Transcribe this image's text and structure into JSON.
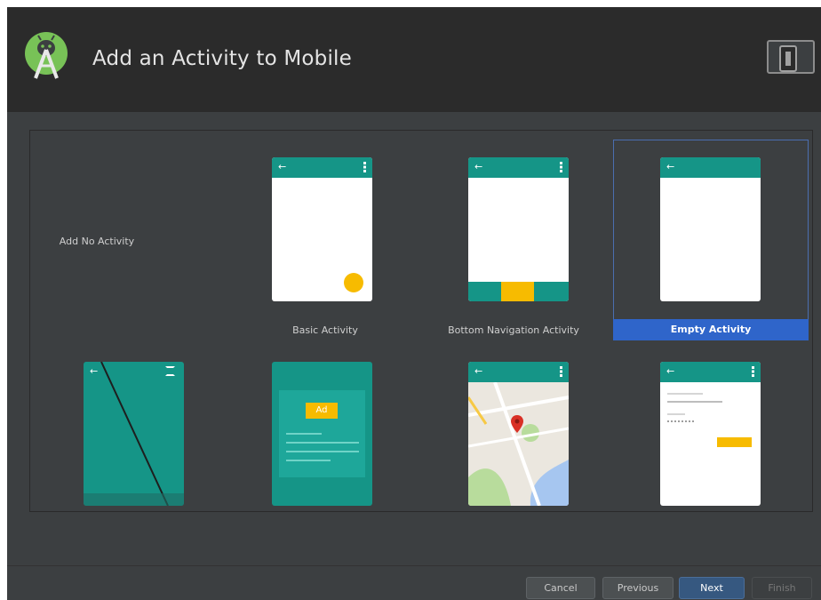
{
  "dialog": {
    "title": "Add an Activity to Mobile"
  },
  "tiles": [
    {
      "label": "Add No Activity",
      "selected": false
    },
    {
      "label": "Basic Activity",
      "selected": false
    },
    {
      "label": "Bottom Navigation Activity",
      "selected": false
    },
    {
      "label": "Empty Activity",
      "selected": true
    },
    {
      "label": "",
      "selected": false
    },
    {
      "label": "",
      "selected": false
    },
    {
      "label": "",
      "selected": false
    },
    {
      "label": "",
      "selected": false
    }
  ],
  "fullscreen_preview": {
    "back_icon": "arrow-back-icon",
    "expand_icon": "fullscreen-icon"
  },
  "ad_preview": {
    "badge": "Ad"
  },
  "map_preview": {
    "pin_icon": "map-pin-icon"
  },
  "buttons": {
    "cancel": "Cancel",
    "previous": "Previous",
    "next": "Next",
    "finish": "Finish"
  },
  "colors": {
    "teal": "#159587",
    "accent": "#f7bb00",
    "selection": "#2f65ca",
    "dialog_bg": "#3c3f41",
    "header_bg": "#2b2b2b"
  }
}
